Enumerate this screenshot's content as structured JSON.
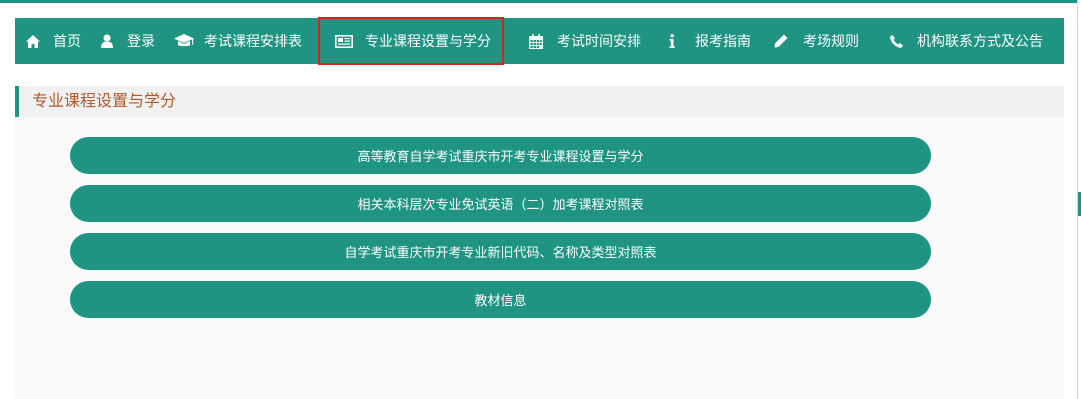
{
  "nav": {
    "items": [
      {
        "label": "首页",
        "icon": "home-icon"
      },
      {
        "label": "登录",
        "icon": "user-icon"
      },
      {
        "label": "考试课程安排表",
        "icon": "graduation-cap-icon"
      },
      {
        "label": "专业课程设置与学分",
        "icon": "newspaper-icon",
        "active": true
      },
      {
        "label": "考试时间安排",
        "icon": "calendar-icon"
      },
      {
        "label": "报考指南",
        "icon": "info-icon"
      },
      {
        "label": "考场规则",
        "icon": "pencil-icon"
      },
      {
        "label": "机构联系方式及公告",
        "icon": "phone-icon"
      }
    ]
  },
  "section": {
    "title": "专业课程设置与学分",
    "links": [
      "高等教育自学考试重庆市开考专业课程设置与学分",
      "相关本科层次专业免试英语（二）加考课程对照表",
      "自学考试重庆市开考专业新旧代码、名称及类型对照表",
      "教材信息"
    ]
  },
  "colors": {
    "primary": "#1f9483",
    "title_text": "#b05a2a",
    "active_outline": "#e02020",
    "section_bg": "#f9f9f9",
    "header_bg": "#f1f1f1"
  }
}
